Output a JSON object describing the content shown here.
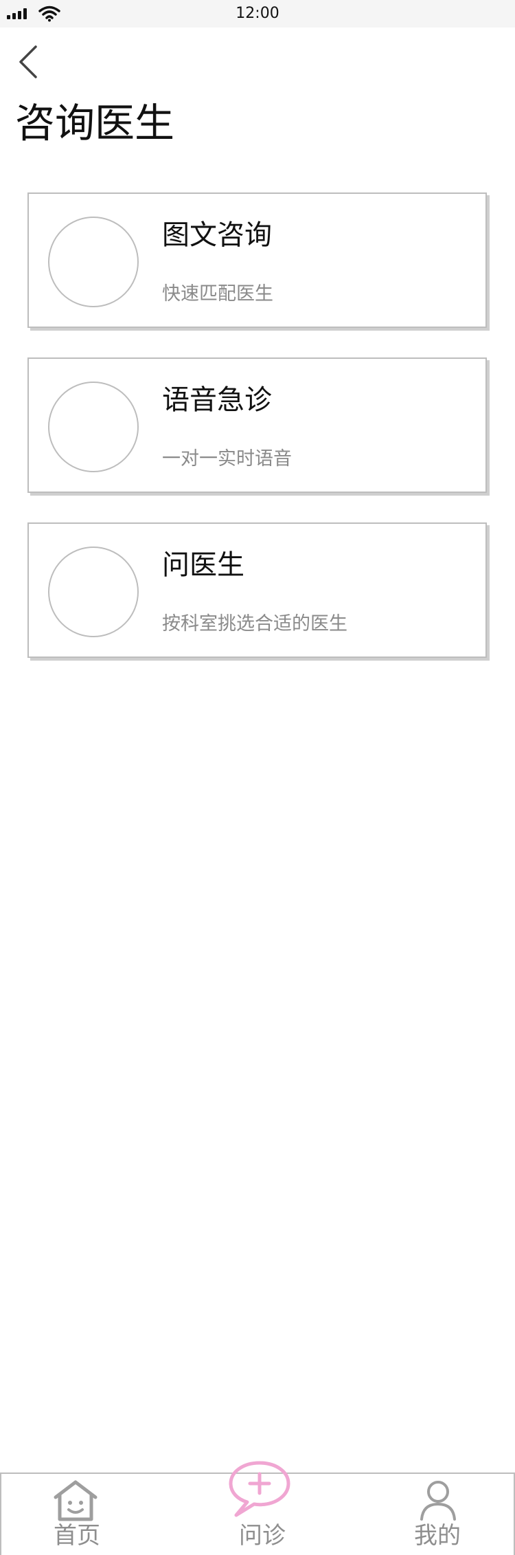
{
  "status_bar": {
    "time": "12:00",
    "icons": [
      "signal-icon",
      "wifi-icon"
    ]
  },
  "header": {
    "back_icon": "chevron-left-icon",
    "title": "咨询医生"
  },
  "options": [
    {
      "title": "图文咨询",
      "subtitle": "快速匹配医生"
    },
    {
      "title": "语音急诊",
      "subtitle": "一对一实时语音"
    },
    {
      "title": "问医生",
      "subtitle": "按科室挑选合适的医生"
    }
  ],
  "tab_bar": {
    "tabs": [
      {
        "label": "首页",
        "icon": "home-icon"
      },
      {
        "label": "问诊",
        "icon": "chat-plus-icon",
        "active_color": "#f0a6d2"
      },
      {
        "label": "我的",
        "icon": "user-icon"
      }
    ]
  },
  "colors": {
    "border": "#bdbdbd",
    "muted_text": "#8a8a8a",
    "accent_pink": "#f0a6d2"
  }
}
